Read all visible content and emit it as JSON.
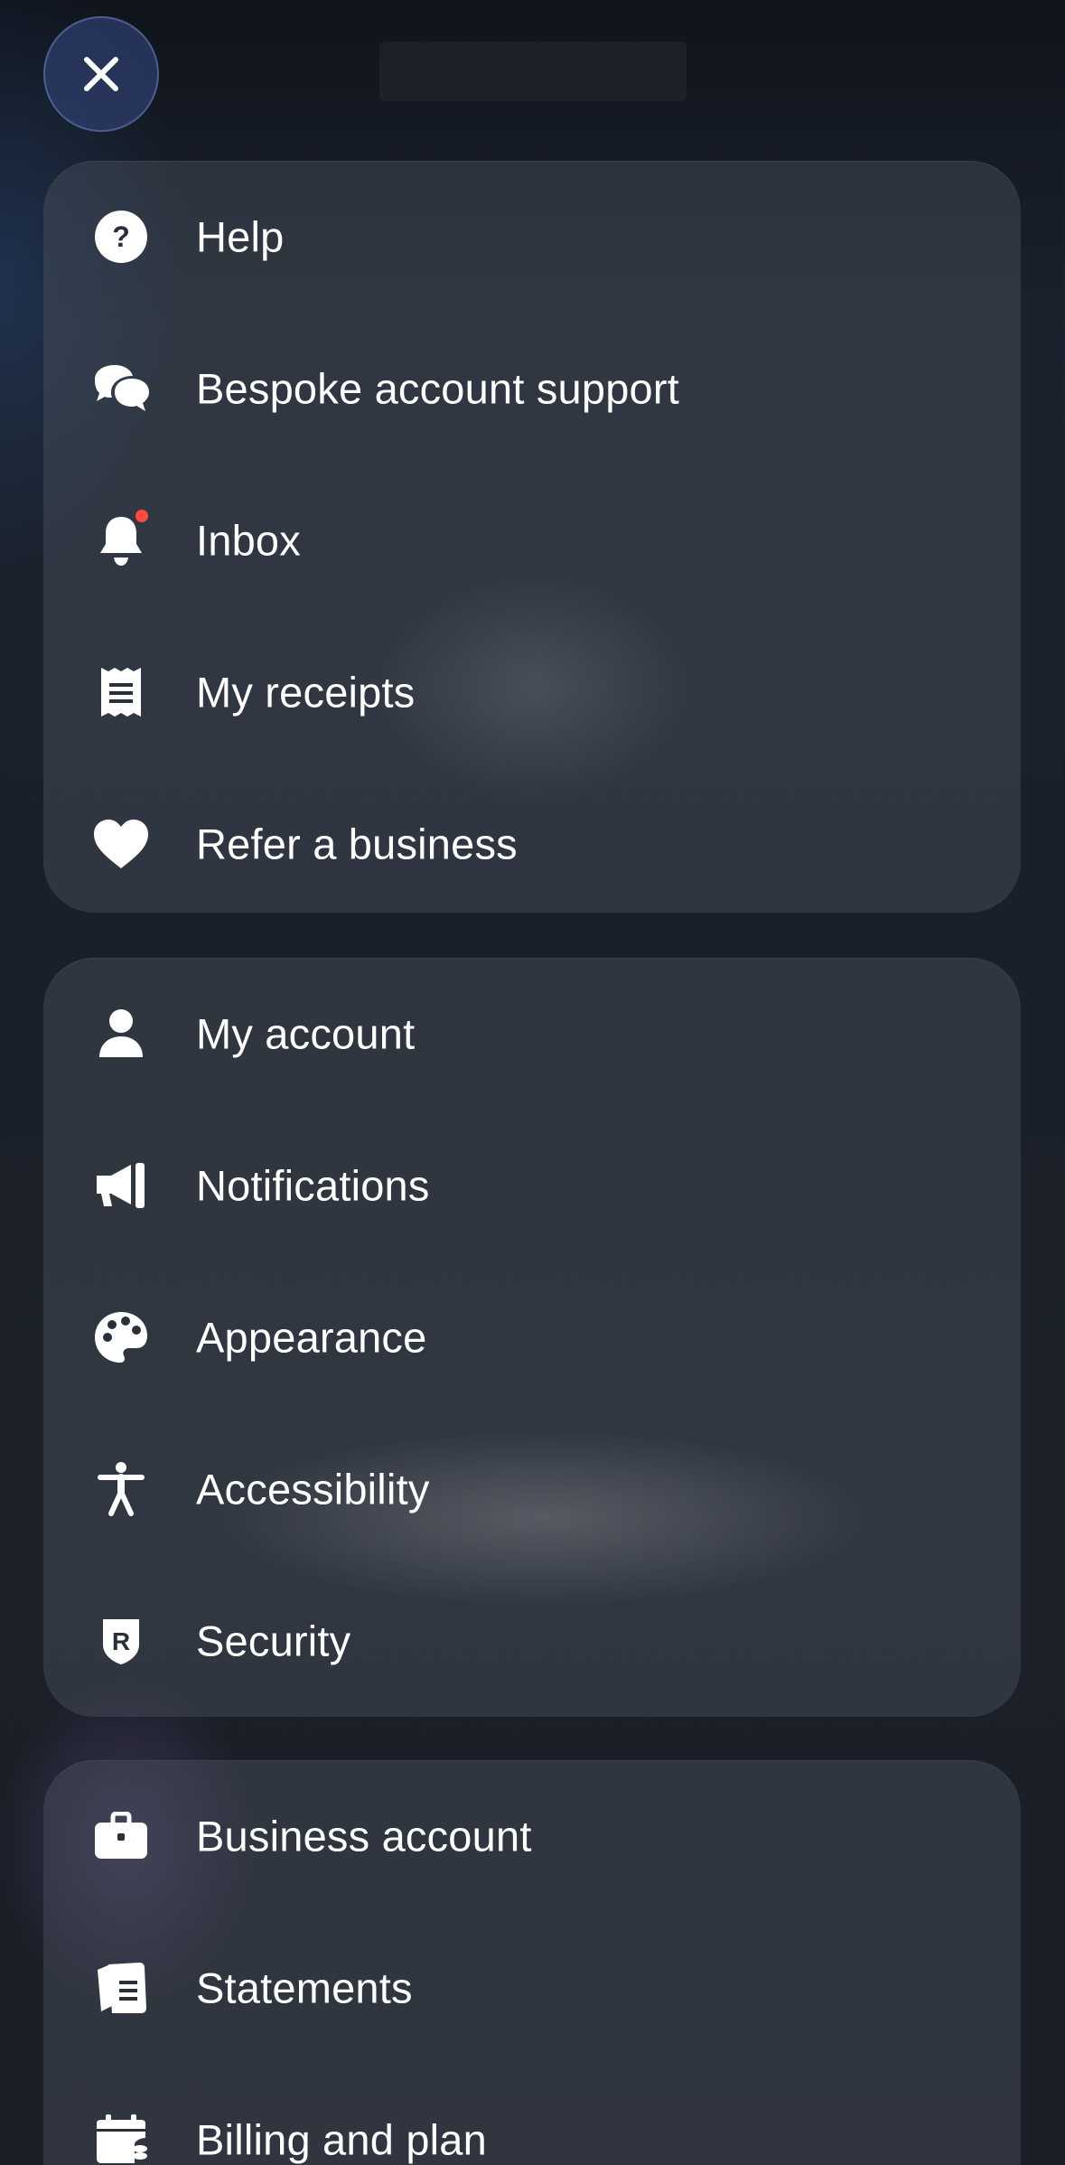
{
  "header": {
    "close_icon": "close-icon"
  },
  "menu": {
    "group_1": [
      {
        "label": "Help",
        "icon": "help-circle-icon"
      },
      {
        "label": "Bespoke account support",
        "icon": "chat-bubbles-icon"
      },
      {
        "label": "Inbox",
        "icon": "bell-icon",
        "has_notification_dot": true
      },
      {
        "label": "My receipts",
        "icon": "receipt-icon"
      },
      {
        "label": "Refer a business",
        "icon": "heart-icon"
      }
    ],
    "group_2": [
      {
        "label": "My account",
        "icon": "person-icon"
      },
      {
        "label": "Notifications",
        "icon": "megaphone-icon"
      },
      {
        "label": "Appearance",
        "icon": "palette-icon"
      },
      {
        "label": "Accessibility",
        "icon": "accessibility-icon"
      },
      {
        "label": "Security",
        "icon": "shield-r-icon"
      }
    ],
    "group_3": [
      {
        "label": "Business account",
        "icon": "briefcase-icon"
      },
      {
        "label": "Statements",
        "icon": "documents-icon"
      },
      {
        "label": "Billing and plan",
        "icon": "calendar-coins-icon"
      }
    ]
  },
  "colors": {
    "notification_dot": "#ff4a3d",
    "close_button_bg": "#2d3e6c",
    "text": "#ffffff"
  }
}
